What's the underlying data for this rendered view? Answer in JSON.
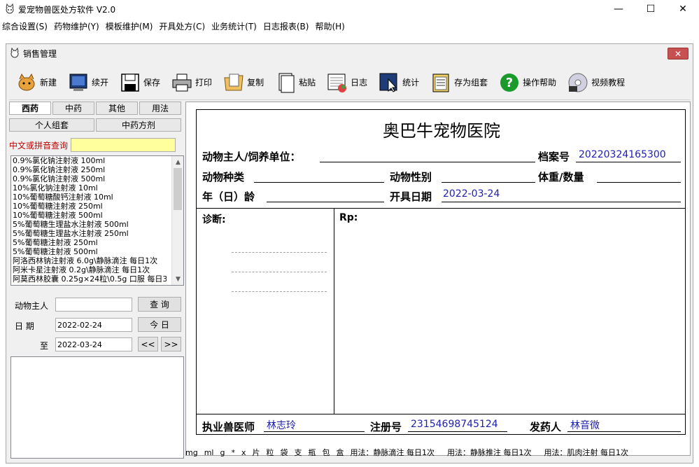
{
  "window": {
    "title": "爱宠物兽医处方软件 V2.0",
    "minimize": "—",
    "maximize": "☐",
    "close": "✕"
  },
  "menu": [
    "综合设置(S)",
    "药物维护(Y)",
    "模板维护(M)",
    "开具处方(C)",
    "业务统计(T)",
    "日志报表(B)",
    "帮助(H)"
  ],
  "mdi": {
    "title": "销售管理",
    "close": "✕"
  },
  "toolbar": [
    {
      "label": "新建",
      "icon": "new-icon"
    },
    {
      "label": "续开",
      "icon": "continue-icon"
    },
    {
      "label": "保存",
      "icon": "save-icon"
    },
    {
      "label": "打印",
      "icon": "print-icon"
    },
    {
      "label": "复制",
      "icon": "copy-icon"
    },
    {
      "label": "粘贴",
      "icon": "paste-icon"
    },
    {
      "label": "日志",
      "icon": "log-icon"
    },
    {
      "label": "统计",
      "icon": "stats-icon"
    },
    {
      "label": "存为组套",
      "icon": "saveset-icon"
    },
    {
      "label": "操作帮助",
      "icon": "help-icon"
    },
    {
      "label": "视频教程",
      "icon": "video-icon"
    }
  ],
  "tabs_row1": [
    "西药",
    "中药",
    "其他",
    "用法"
  ],
  "tabs_row2": [
    "个人组套",
    "中药方剂"
  ],
  "search": {
    "label": "中文或拼音查询",
    "value": ""
  },
  "drugs": [
    "0.9%氯化钠注射液  100ml",
    "0.9%氯化钠注射液  250ml",
    "0.9%氯化钠注射液  500ml",
    "10%氯化钠注射液  10ml",
    "10%葡萄糖酸钙注射液  10ml",
    "10%葡萄糖注射液  250ml",
    "10%葡萄糖注射液  500ml",
    "5%葡萄糖生理盐水注射液  500ml",
    "5%葡萄糖生理盐水注射液 250ml",
    "5%葡萄糖注射液  250ml",
    "5%葡萄糖注射液  500ml",
    "阿洛西林钠注射液 6.0g\\静脉滴注  每日1次",
    "阿米卡星注射液  0.2g\\静脉滴注  每日1次",
    "阿莫西林胶囊 0.25g×24粒\\0.5g 口服 每日3"
  ],
  "filter": {
    "owner_label": "动物主人",
    "owner_value": "",
    "query_btn": "查 询",
    "date_label": "日  期",
    "date_from": "2022-02-24",
    "today_btn": "今 日",
    "to_label": "至",
    "date_to": "2022-03-24",
    "prev_btn": "<<",
    "next_btn": ">>"
  },
  "rx": {
    "hospital": "奥巴牛宠物医院",
    "owner_label": "动物主人/饲养单位：",
    "file_label": "档案号",
    "file_value": "20220324165300",
    "species_label": "动物种类",
    "sex_label": "动物性别",
    "weight_label": "体重/数量",
    "age_label": "年（日）龄",
    "date_label": "开具日期",
    "date_value": "2022-03-24",
    "diagnosis_label": "诊断:",
    "rp_label": "Rp:",
    "vet_label": "执业兽医师",
    "vet_value": "林志玲",
    "reg_label": "注册号",
    "reg_value": "23154698745124",
    "dispense_label": "发药人",
    "dispense_value": "林音微"
  },
  "footer": [
    "mg",
    "ml",
    "g",
    "*",
    "x",
    "片",
    "粒",
    "袋",
    "支",
    "瓶",
    "包",
    "盒",
    "用法：静脉滴注 每日1次",
    "用法：静脉推注 每日1次",
    "用法：肌肉注射 每日1次"
  ]
}
